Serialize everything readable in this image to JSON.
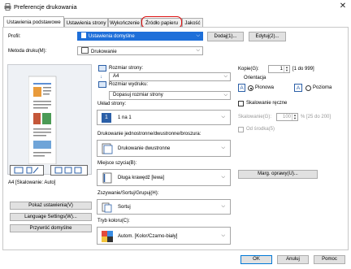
{
  "window": {
    "title": "Preferencje drukowania",
    "close": "✕"
  },
  "tabs": [
    {
      "label": "Ustawienia podstawowe"
    },
    {
      "label": "Ustawienia strony"
    },
    {
      "label": "Wykończenie"
    },
    {
      "label": "Źródło papieru"
    },
    {
      "label": "Jakość"
    }
  ],
  "profile": {
    "label": "Profil:",
    "value": "Ustawienia domyślne",
    "add": "Dodaj(1)...",
    "edit": "Edytuj(2)..."
  },
  "output": {
    "label": "Metoda druku(M):",
    "value": "Drukowanie"
  },
  "preview": {
    "caption": "A4 [Skalowanie: Auto]"
  },
  "buttons": {
    "show": "Pokaż ustawienia(V)",
    "language": "Language Settings(W)...",
    "defaults": "Przywróć domyślne"
  },
  "page_size": {
    "label": "Rozmiar strony:",
    "value": "A4"
  },
  "output_size": {
    "label": "Rozmiar wydruku:",
    "value": "Dopasuj rozmiar strony"
  },
  "layout": {
    "label": "Układ strony:",
    "value": "1 na 1"
  },
  "duplex": {
    "label": "Drukowanie jednostronne/dwustronne/broszura:",
    "value": "Drukowanie dwustronne"
  },
  "binding": {
    "label": "Miejsce szycia(B):",
    "value": "Długa krawędź [lewa]",
    "margin_btn": "Marg. oprawy(U)..."
  },
  "collate": {
    "label": "Zszywanie/Sortuj/Grupuj(H):",
    "value": "Sortuj"
  },
  "color": {
    "label": "Tryb koloru(C):",
    "value": "Autom. [Kolor/Czarno-biały]"
  },
  "copies": {
    "label": "Kopie(G):",
    "value": "1",
    "range": "[1 do 999]"
  },
  "orientation": {
    "label": "Orientacja",
    "portrait": "Pionowa",
    "landscape": "Pozioma"
  },
  "scaling": {
    "label": "Skalowanie ręczne",
    "sub_label": "Skalowanie(G):",
    "value": "100",
    "range": "% [25 do 200]",
    "center": "Od środka(5)"
  },
  "footer": {
    "ok": "OK",
    "cancel": "Anuluj",
    "help": "Pomoc"
  },
  "colors": {
    "highlight": "#dd1111",
    "selection": "#1e6fd9"
  }
}
